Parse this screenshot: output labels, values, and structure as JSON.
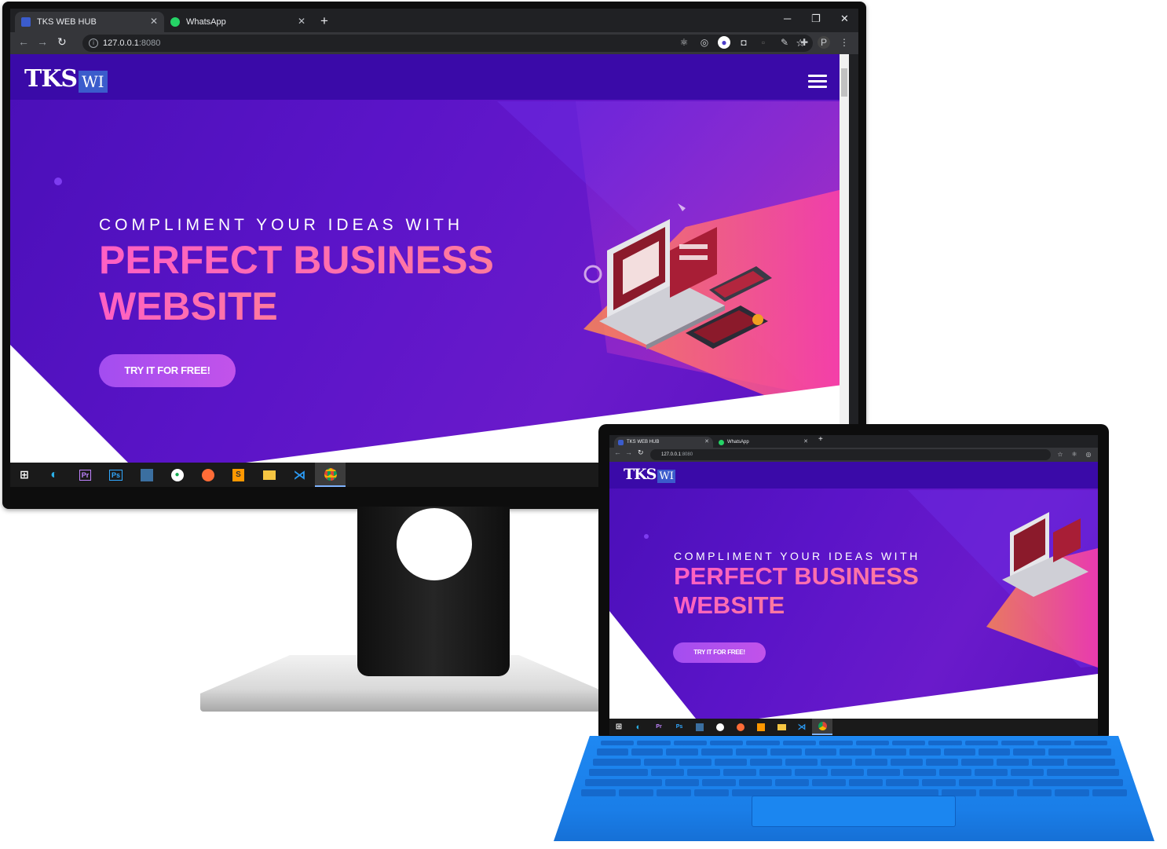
{
  "monitor": {
    "tabs": [
      {
        "title": "TKS WEB HUB",
        "favicon": "tks-favicon",
        "active": true
      },
      {
        "title": "WhatsApp",
        "favicon": "whatsapp-icon",
        "active": false
      }
    ],
    "new_tab": "+",
    "window_controls": {
      "minimize": "─",
      "restore": "❐",
      "close": "✕"
    },
    "address": {
      "host": "127.0.0.1",
      "port": ":8080"
    },
    "site": {
      "logo_main": "TKS",
      "logo_badge": "WI",
      "pre_title": "COMPLIMENT YOUR IDEAS WITH",
      "title_line1": "PERFECT BUSINESS",
      "title_line2": "WEBSITE",
      "cta_label": "TRY IT FOR FREE!"
    },
    "taskbar_icons": [
      "windows-start-icon",
      "edge-icon",
      "premiere-icon",
      "photoshop-icon",
      "mysql-workbench-icon",
      "mongodb-icon",
      "postman-icon",
      "sublime-icon",
      "file-explorer-icon",
      "vscode-icon",
      "chrome-icon"
    ]
  },
  "tablet": {
    "tabs": [
      {
        "title": "TKS WEB HUB",
        "active": true
      },
      {
        "title": "WhatsApp",
        "active": false
      }
    ],
    "address": {
      "host": "127.0.0.1",
      "port": ":8080"
    },
    "site": {
      "logo_main": "TKS",
      "logo_badge": "WI",
      "pre_title": "COMPLIMENT YOUR IDEAS WITH",
      "title_line1": "PERFECT BUSINESS",
      "title_line2": "WEBSITE",
      "cta_label": "TRY IT FOR FREE!"
    }
  },
  "colors": {
    "hero_purple": "#5b14c8",
    "title_pink": "#ff5fc4",
    "cta_purple": "#a34df0",
    "keyboard_blue": "#1e88f2"
  }
}
